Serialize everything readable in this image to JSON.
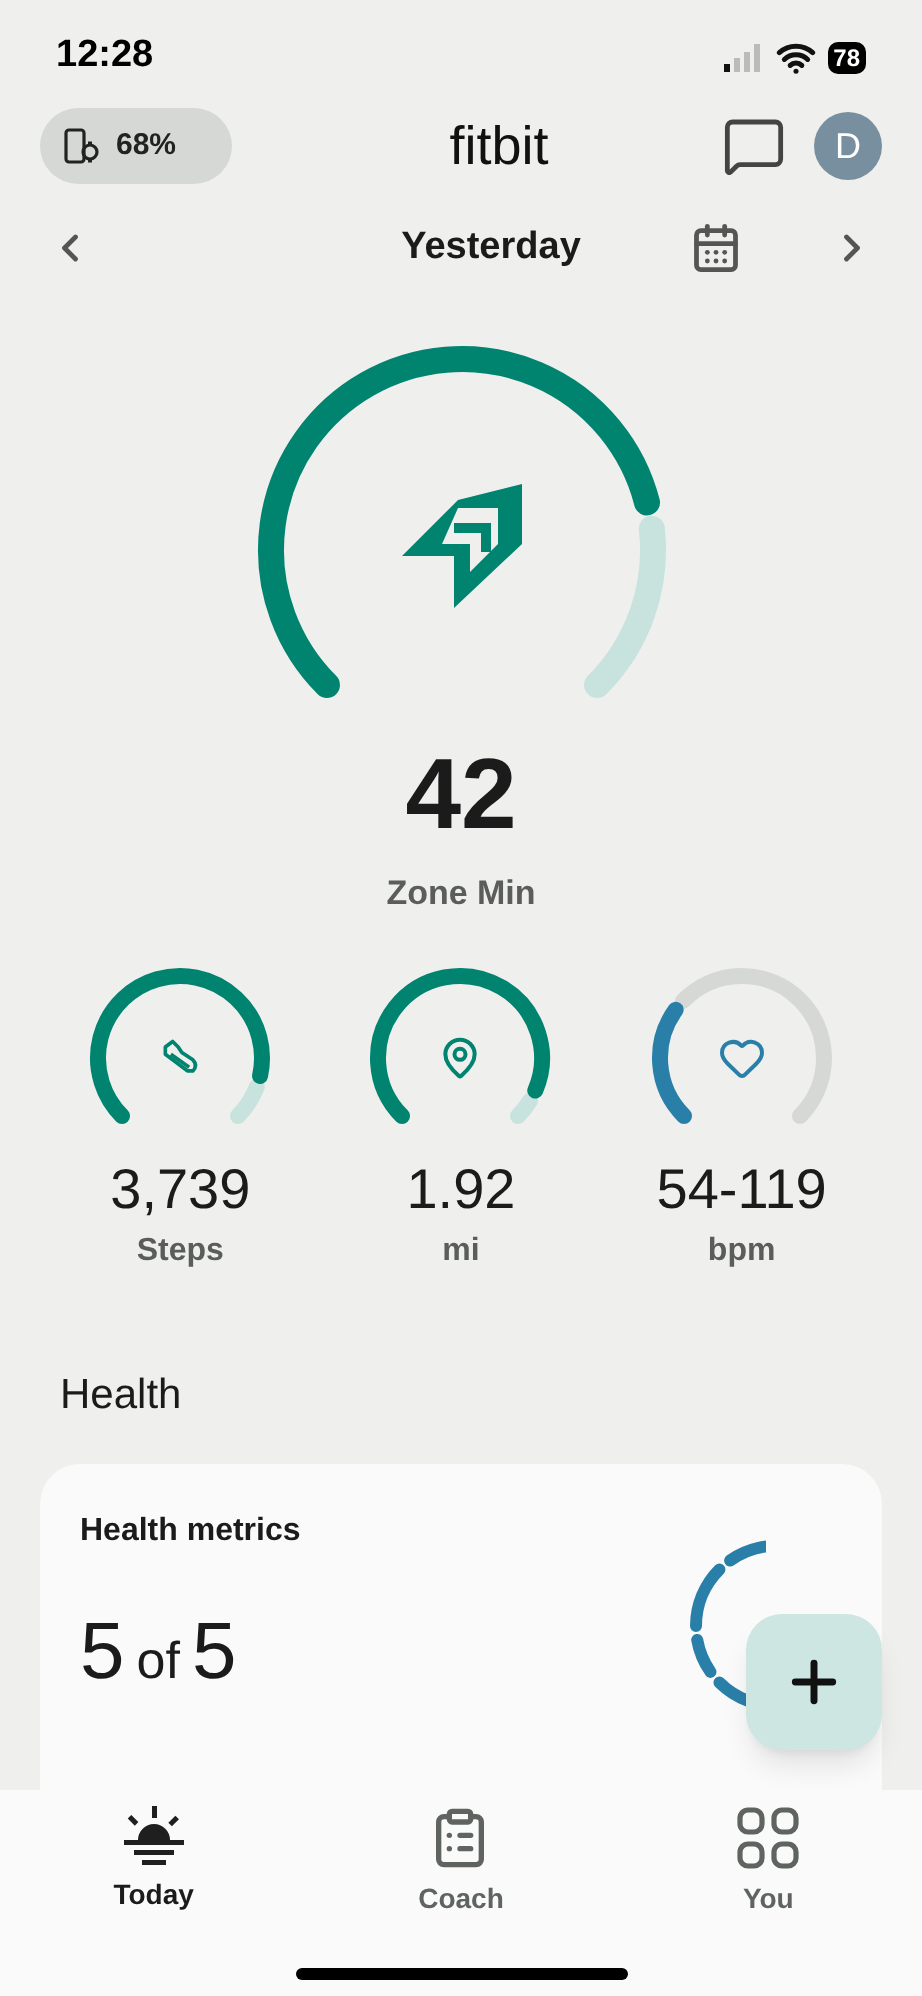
{
  "status_bar": {
    "time": "12:28",
    "battery": "78"
  },
  "header": {
    "device_battery": "68%",
    "logo": "fitbit",
    "avatar": "D"
  },
  "date_nav": {
    "label": "Yesterday"
  },
  "main_metric": {
    "value": "42",
    "label": "Zone Min"
  },
  "metrics": [
    {
      "kind": "steps",
      "value": "3,739",
      "unit": "Steps"
    },
    {
      "kind": "distance",
      "value": "1.92",
      "unit": "mi"
    },
    {
      "kind": "heart",
      "value": "54-119",
      "unit": "bpm"
    }
  ],
  "section_title": "Health",
  "health_card": {
    "title": "Health metrics",
    "count": "5",
    "connector": "of",
    "total": "5"
  },
  "tabs": [
    {
      "label": "Today",
      "kind": "today",
      "selected": true
    },
    {
      "label": "Coach",
      "kind": "coach",
      "selected": false
    },
    {
      "label": "You",
      "kind": "you",
      "selected": false
    }
  ]
}
